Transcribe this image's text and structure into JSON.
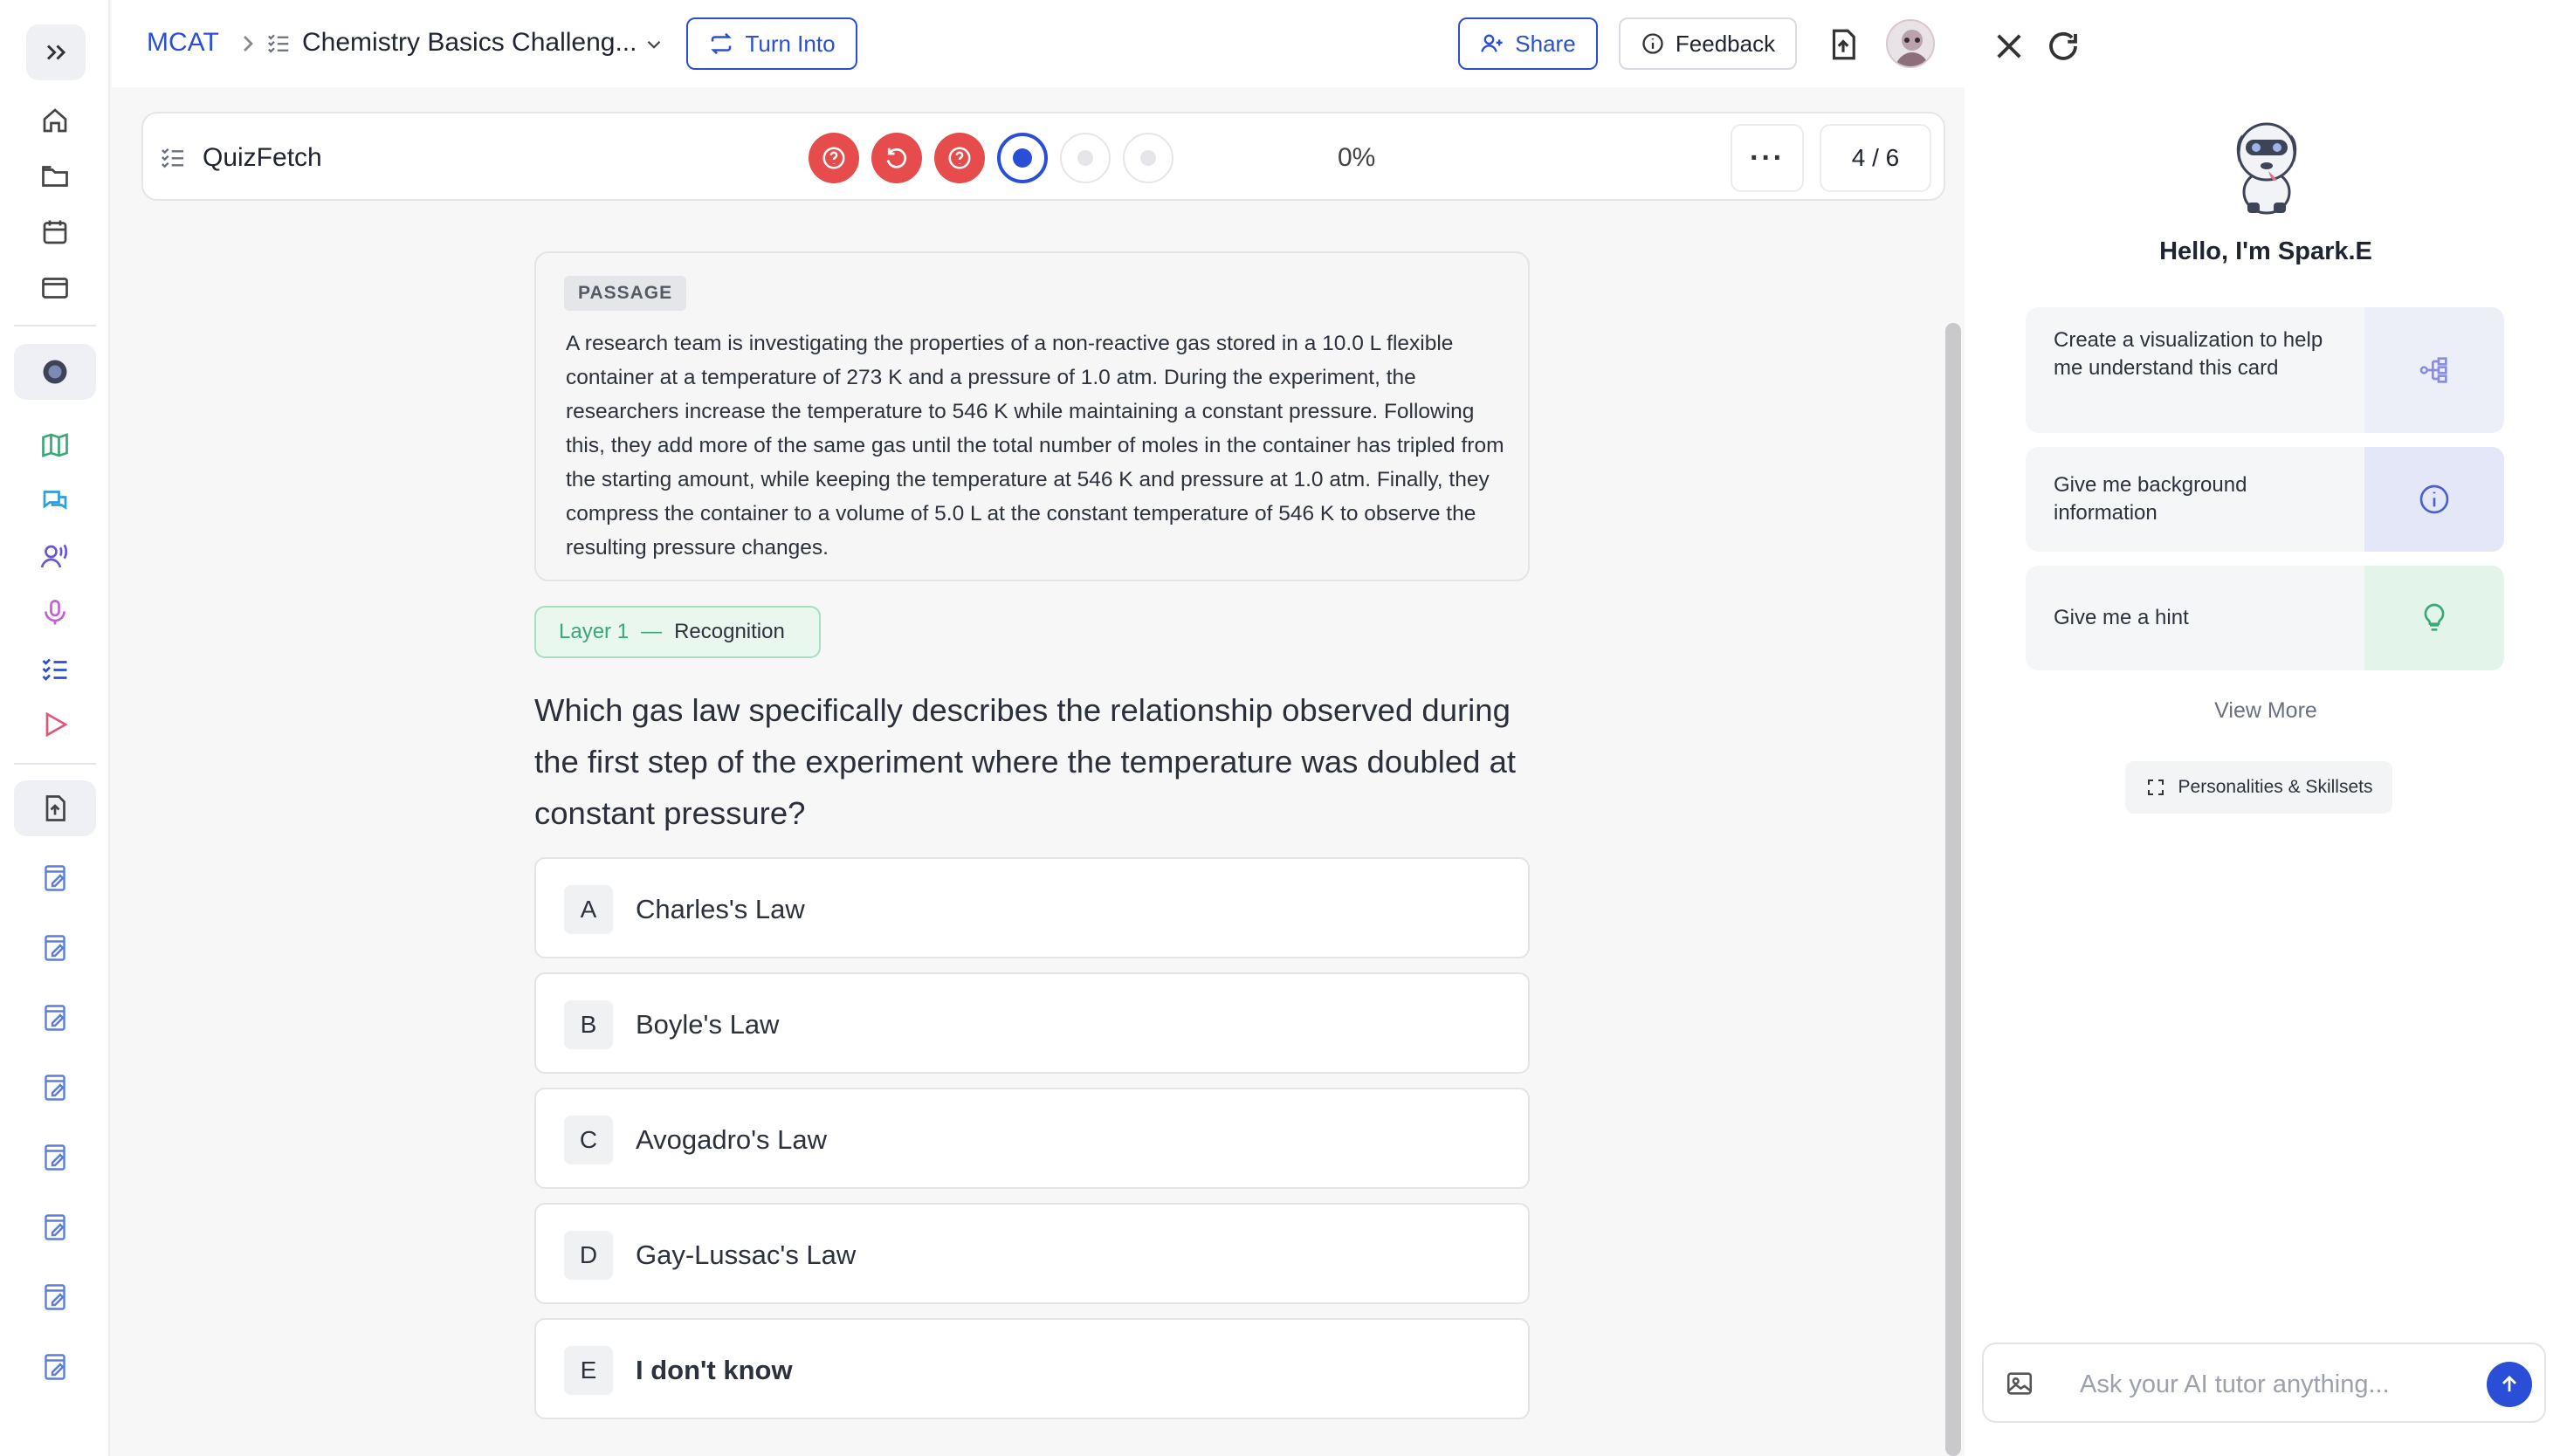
{
  "breadcrumb": {
    "root": "MCAT",
    "title": "Chemistry Basics Challeng..."
  },
  "toolbar": {
    "turn_into_label": "Turn Into",
    "share_label": "Share",
    "feedback_label": "Feedback"
  },
  "quiz": {
    "title": "QuizFetch",
    "progress_percent": "0%",
    "counter": "4 / 6",
    "more_label": "···",
    "question_states": [
      "incorrect",
      "retry",
      "incorrect",
      "current",
      "unanswered",
      "unanswered"
    ]
  },
  "passage": {
    "tag": "PASSAGE",
    "text": "A research team is investigating the properties of a non-reactive gas stored in a 10.0 L flexible container at a temperature of 273 K and a pressure of 1.0 atm. During the experiment, the researchers increase the temperature to 546 K while maintaining a constant pressure. Following this, they add more of the same gas until the total number of moles in the container has tripled from the starting amount, while keeping the temperature at 546 K and pressure at 1.0 atm. Finally, they compress the container to a volume of 5.0 L at the constant temperature of 546 K to observe the resulting pressure changes."
  },
  "layer": {
    "label": "Layer 1",
    "separator": "—",
    "name": "Recognition"
  },
  "question": "Which gas law specifically describes the relationship observed during the first step of the experiment where the temperature was doubled at constant pressure?",
  "options": [
    {
      "letter": "A",
      "text": "Charles's Law"
    },
    {
      "letter": "B",
      "text": "Boyle's Law"
    },
    {
      "letter": "C",
      "text": "Avogadro's Law"
    },
    {
      "letter": "D",
      "text": "Gay-Lussac's Law"
    },
    {
      "letter": "E",
      "text": "I don't know"
    }
  ],
  "assistant": {
    "greeting": "Hello, I'm Spark.E",
    "cards": [
      {
        "text": "Create a visualization to help me understand this card",
        "icon": "diagram-icon"
      },
      {
        "text": "Give me background information",
        "icon": "info-icon"
      },
      {
        "text": "Give me a hint",
        "icon": "lightbulb-icon"
      }
    ],
    "view_more": "View More",
    "personalities_label": "Personalities & Skillsets",
    "input_placeholder": "Ask your AI tutor anything..."
  },
  "colors": {
    "accent": "#2a4fd6",
    "error": "#e74c4c",
    "success": "#3aa877"
  }
}
